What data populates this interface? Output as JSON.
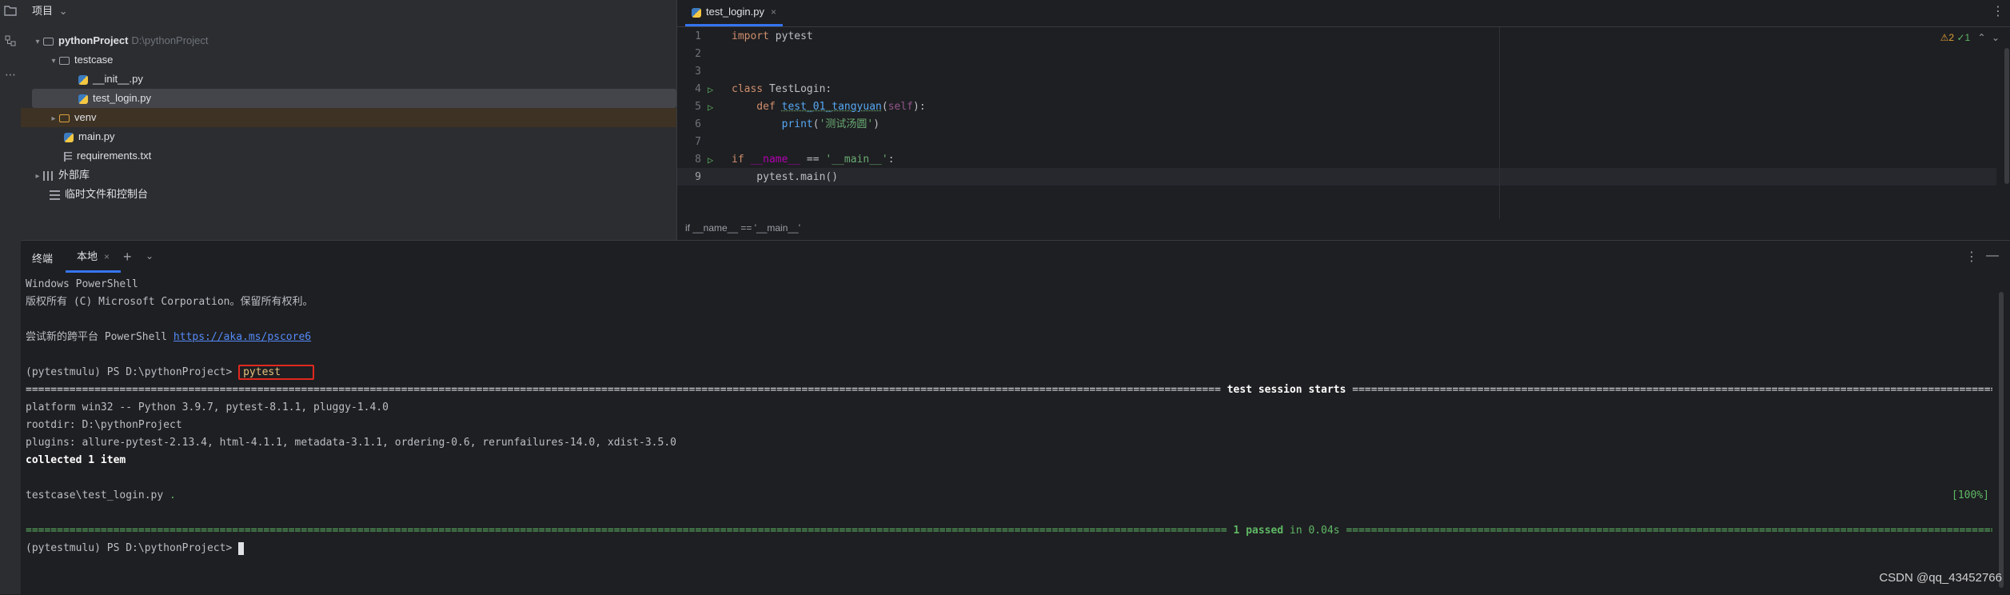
{
  "activity_bar": {
    "icons": [
      "folder-icon",
      "structure-icon",
      "more-icon"
    ]
  },
  "project": {
    "header": "项目",
    "header_chevron": "⌄",
    "tree": [
      {
        "label": "pythonProject",
        "hint": "D:\\pythonProject",
        "type": "folder",
        "expanded": true
      },
      {
        "label": "testcase",
        "type": "folder",
        "expanded": true
      },
      {
        "label": "__init__.py",
        "type": "python"
      },
      {
        "label": "test_login.py",
        "type": "python",
        "selected": true
      },
      {
        "label": "venv",
        "type": "folder",
        "expanded": false
      },
      {
        "label": "main.py",
        "type": "python"
      },
      {
        "label": "requirements.txt",
        "type": "text"
      },
      {
        "label": "外部库",
        "type": "library",
        "expanded": false
      },
      {
        "label": "临时文件和控制台",
        "type": "scratches"
      }
    ]
  },
  "editor": {
    "tab_label": "test_login.py",
    "tab_close": "×",
    "menu": "⋮",
    "inspection": {
      "warnings": "⚠2",
      "ok": "✓1",
      "up": "⌃",
      "down": "⌄"
    },
    "lines": [
      {
        "no": "1",
        "run": false
      },
      {
        "no": "2",
        "run": false
      },
      {
        "no": "3",
        "run": false
      },
      {
        "no": "4",
        "run": true
      },
      {
        "no": "5",
        "run": true
      },
      {
        "no": "6",
        "run": false
      },
      {
        "no": "7",
        "run": false
      },
      {
        "no": "8",
        "run": true
      },
      {
        "no": "9",
        "run": false
      }
    ],
    "code": {
      "l1_kw": "import",
      "l1_rest": " pytest",
      "l4_kw": "class",
      "l4_name": " TestLogin:",
      "l5_kw": "    def",
      "l5_sp": " ",
      "l5_fn": "test_01_tangyuan",
      "l5_paren": "(",
      "l5_self": "self",
      "l5_close": "):",
      "l6_fn": "        print",
      "l6_open": "(",
      "l6_str": "'测试汤圆'",
      "l6_close": ")",
      "l8_kw": "if",
      "l8_dunder": " __name__",
      "l8_eq": " == ",
      "l8_str": "'__main__'",
      "l8_colon": ":",
      "l9_code": "    pytest.main()"
    },
    "breadcrumb": "if __name__ == '__main__'"
  },
  "terminal": {
    "title": "终端",
    "tab_label": "本地",
    "tab_close": "×",
    "add": "+",
    "dropdown": "⌄",
    "menu": "⋮",
    "minimize": "—",
    "lines": {
      "l1": "Windows PowerShell",
      "l2": "版权所有 (C) Microsoft Corporation。保留所有权利。",
      "l4_prefix": "尝试新的跨平台 PowerShell ",
      "l4_link": "https://aka.ms/pscore6",
      "prompt": "(pytestmulu) PS D:\\pythonProject> ",
      "command": "pytest",
      "session_left": "=============================================================================================================================================================================================== ",
      "session_title": "test session starts",
      "session_right": " ===============================================================================================================================================================================================",
      "platform": "platform win32 -- Python 3.9.7, pytest-8.1.1, pluggy-1.4.0",
      "rootdir": "rootdir: D:\\pythonProject",
      "plugins": "plugins: allure-pytest-2.13.4, html-4.1.1, metadata-3.1.1, ordering-0.6, rerunfailures-14.0, xdist-3.5.0",
      "collected": "collected 1 item",
      "testfile": "testcase\\test_login.py ",
      "testdot": ".",
      "percent": "[100%]",
      "passed_left": "================================================================================================================================================================================================ ",
      "passed_count": "1 passed",
      "passed_time": " in 0.04s ",
      "passed_right": "================================================================================================================================================================================================",
      "final_prompt": "(pytestmulu) PS D:\\pythonProject> "
    }
  },
  "watermark": "CSDN @qq_43452766"
}
